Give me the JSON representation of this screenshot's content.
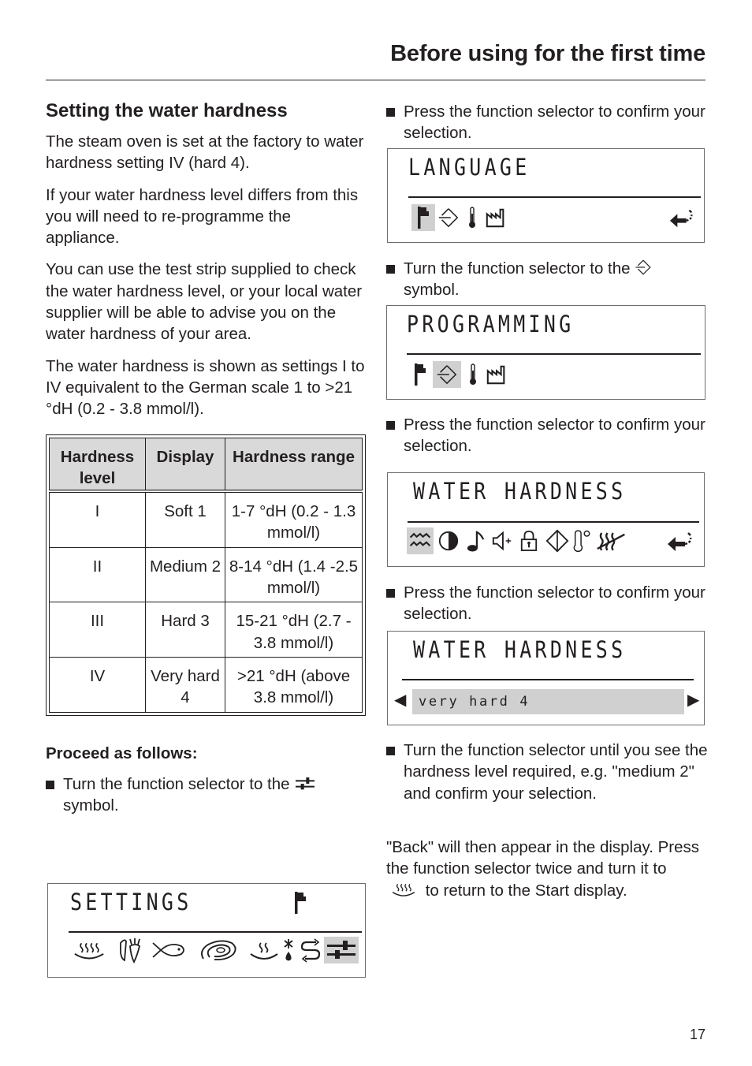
{
  "header": {
    "title": "Before using for the first time"
  },
  "left": {
    "section_title": "Setting the water hardness",
    "paragraphs": [
      "The steam oven is set at the factory to water hardness setting IV (hard 4).",
      "If your water hardness level differs from this you will need to re-programme the appliance.",
      "You can use the test strip supplied to check the water hardness level, or your local water supplier will be able to advise you on the water hardness of your area.",
      "The water hardness is shown as settings I to IV equivalent to the German scale 1 to >21 °dH (0.2 - 3.8 mmol/l)."
    ],
    "table": {
      "headers": [
        "Hardness level",
        "Display",
        "Hardness range"
      ],
      "rows": [
        {
          "level": "I",
          "display": "Soft 1",
          "range": "1-7 °dH (0.2 - 1.3 mmol/l)"
        },
        {
          "level": "II",
          "display": "Medium 2",
          "range": "8-14 °dH (1.4 -2.5 mmol/l)"
        },
        {
          "level": "III",
          "display": "Hard 3",
          "range": "15-21 °dH (2.7 - 3.8 mmol/l)"
        },
        {
          "level": "IV",
          "display": "Very hard 4",
          "range": ">21 °dH (above 3.8 mmol/l)"
        }
      ]
    },
    "proceed_heading": "Proceed as follows:",
    "step1_before": "Turn the function selector to the",
    "step1_after": "symbol.",
    "settings_display": {
      "title": "SETTINGS",
      "icons": [
        "steam-cooking-icon",
        "vegetables-icon",
        "fish-icon",
        "meat-icon",
        "reheat-icon",
        "defrost-icon",
        "auto-programme-icon",
        "settings-sliders-icon"
      ],
      "selected": "settings-sliders-icon",
      "corner_icon": "flag-icon"
    }
  },
  "right": {
    "step2": "Press the function selector to confirm your selection.",
    "language_display": {
      "title": "LANGUAGE",
      "icons": [
        "flag-icon",
        "programming-diamond-icon",
        "thermometer-icon",
        "factory-icon"
      ],
      "selected": "flag-icon",
      "back_icon": "back-arrow-icon"
    },
    "step3_before": "Turn the function selector to the",
    "step3_after": "symbol.",
    "programming_display": {
      "title": "PROGRAMMING",
      "icons": [
        "flag-icon",
        "programming-diamond-icon",
        "thermometer-icon",
        "factory-icon"
      ],
      "selected": "programming-diamond-icon"
    },
    "step4": "Press the function selector to confirm your selection.",
    "water_hardness_menu": {
      "title": "WATER HARDNESS",
      "icons": [
        "water-hardness-icon",
        "contrast-icon",
        "music-note-icon",
        "volume-plus-icon",
        "lock-icon",
        "start-diamond-icon",
        "temperature-unit-icon",
        "steam-reduction-icon"
      ],
      "selected": "water-hardness-icon",
      "back_icon": "back-arrow-icon"
    },
    "step5": "Press the function selector to confirm your selection.",
    "water_hardness_value": {
      "title": "WATER HARDNESS",
      "value": "very hard 4",
      "left_arrow": "◀",
      "right_arrow": "▶"
    },
    "step6": "Turn the function selector until you see the hardness level required, e.g. \"medium 2\" and confirm your selection.",
    "final_before": "\"Back\" will then appear in the display. Press the function selector twice and turn it to",
    "final_after": "to return to the Start display."
  },
  "page_number": "17"
}
